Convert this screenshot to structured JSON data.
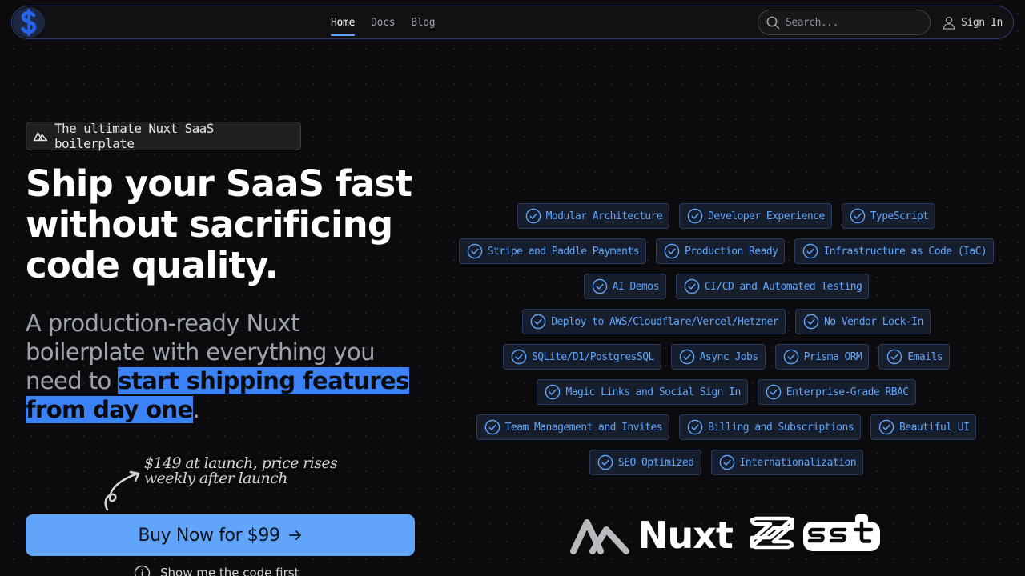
{
  "nav": {
    "links": [
      {
        "label": "Home",
        "active": true
      },
      {
        "label": "Docs",
        "active": false
      },
      {
        "label": "Blog",
        "active": false
      }
    ],
    "search_placeholder": "Search...",
    "signin_label": "Sign In"
  },
  "hero": {
    "badge": "The ultimate Nuxt SaaS boilerplate",
    "headline": "Ship your SaaS fast without sacrificing code quality.",
    "subtitle_prefix": "A production-ready Nuxt boilerplate with everything you need to ",
    "subtitle_highlight": "start shipping features from day one",
    "subtitle_suffix": ".",
    "price_note": "$149 at launch, price rises weekly after launch",
    "buy_label": "Buy Now for $99",
    "code_link": "Show me the code first"
  },
  "features": [
    [
      "Modular Architecture",
      "Developer Experience",
      "TypeScript"
    ],
    [
      "Stripe and Paddle Payments",
      "Production Ready",
      "Infrastructure as Code (IaC)"
    ],
    [
      "AI Demos",
      "CI/CD and Automated Testing"
    ],
    [
      "Deploy to AWS/Cloudflare/Vercel/Hetzner",
      "No Vendor Lock-In"
    ],
    [
      "SQLite/D1/PostgresSQL",
      "Async Jobs",
      "Prisma ORM",
      "Emails"
    ],
    [
      "Magic Links and Social Sign In",
      "Enterprise-Grade RBAC"
    ],
    [
      "Team Management and Invites",
      "Billing and Subscriptions",
      "Beautiful UI"
    ],
    [
      "SEO Optimized",
      "Internationalization"
    ]
  ],
  "brands": {
    "nuxt": "Nuxt",
    "sst": "sst"
  },
  "colors": {
    "accent": "#60a5fa",
    "highlight": "#3b82f6",
    "background": "#0b0b0d"
  },
  "icons": {
    "logo": "dollar-logo-icon",
    "search": "search-icon",
    "user": "user-icon",
    "badge": "nuxt-icon",
    "chip": "check-circle-icon",
    "arrow": "arrow-right-icon",
    "info": "info-icon"
  }
}
